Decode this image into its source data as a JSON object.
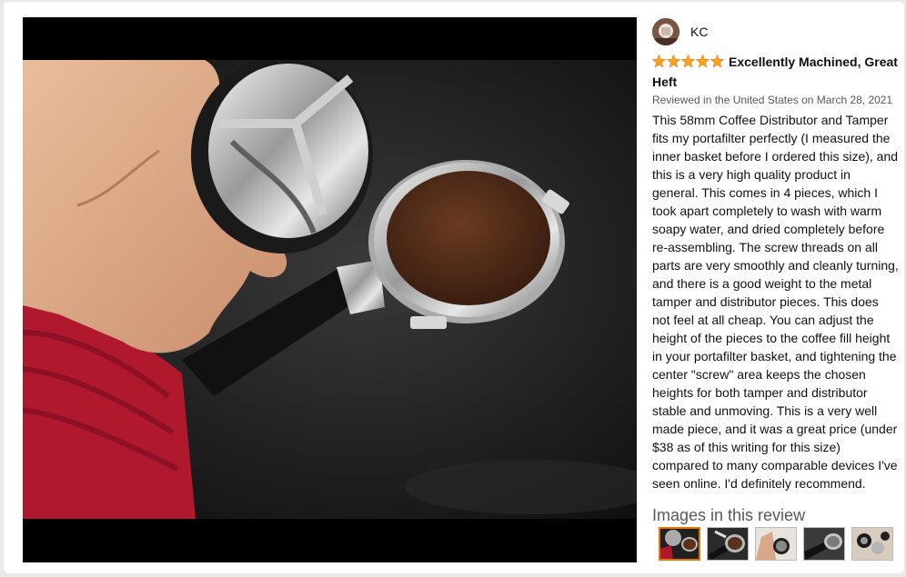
{
  "reviewer": {
    "name": "KC",
    "avatar_icon": "avatar-icon"
  },
  "review": {
    "rating": 5,
    "rating_max": 5,
    "star_color": "#ffa41c",
    "title": "Excellently Machined, Great Heft",
    "date_line": "Reviewed in the United States on March 28, 2021",
    "body": "This 58mm Coffee Distributor and Tamper fits my portafilter perfectly (I measured the inner basket before I ordered this size), and this is a very high quality product in general. This comes in 4 pieces, which I took apart completely to wash with warm soapy water, and dried completely before re-assembling. The screw threads on all parts are very smoothly and cleanly turning, and there is a good weight to the metal tamper and distributor pieces. This does not feel at all cheap. You can adjust the height of the pieces to the coffee fill height in your portafilter basket, and tightening the center \"screw\" area keeps the chosen heights for both tamper and distributor stable and unmoving. This is a very well made piece, and it was a great price (under $38 as of this writing for this size) compared to many comparable devices I've seen online. I'd definitely recommend."
  },
  "images_section": {
    "heading": "Images in this review",
    "thumbnails": 5,
    "selected_index": 0,
    "selected_border_color": "#e77600"
  },
  "main_image": {
    "subject": "hand holding coffee distributor above portafilter with ground coffee"
  }
}
